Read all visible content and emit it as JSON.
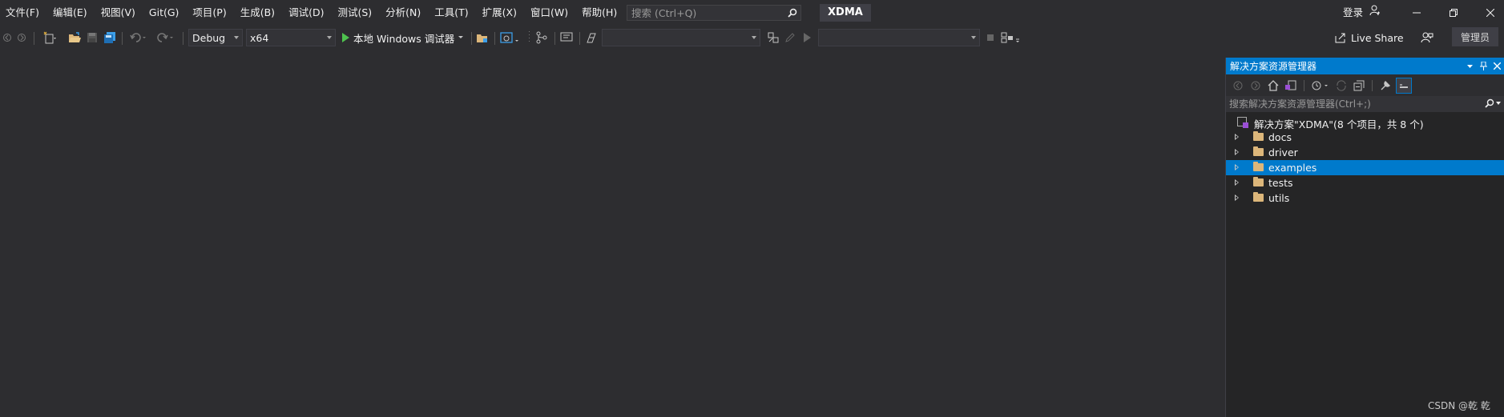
{
  "menu": [
    "文件(F)",
    "编辑(E)",
    "视图(V)",
    "Git(G)",
    "项目(P)",
    "生成(B)",
    "调试(D)",
    "测试(S)",
    "分析(N)",
    "工具(T)",
    "扩展(X)",
    "窗口(W)",
    "帮助(H)"
  ],
  "search": {
    "placeholder": "搜索 (Ctrl+Q)"
  },
  "solution_name": "XDMA",
  "account": {
    "login_label": "登录"
  },
  "toolbar": {
    "config": "Debug",
    "platform": "x64",
    "run_label": "本地 Windows 调试器",
    "live_share": "Live Share",
    "admin_label": "管理员"
  },
  "solution_explorer": {
    "title": "解决方案资源管理器",
    "search_placeholder": "搜索解决方案资源管理器(Ctrl+;)",
    "solution_label": "解决方案\"XDMA\"(8 个项目，共 8 个)",
    "folders": [
      {
        "label": "docs"
      },
      {
        "label": "driver"
      },
      {
        "label": "examples",
        "selected": true
      },
      {
        "label": "tests"
      },
      {
        "label": "utils"
      }
    ]
  },
  "watermark": "CSDN @乾 乾",
  "colors": {
    "accent": "#007acc",
    "background": "#2d2d30",
    "folder": "#dcb67a"
  }
}
